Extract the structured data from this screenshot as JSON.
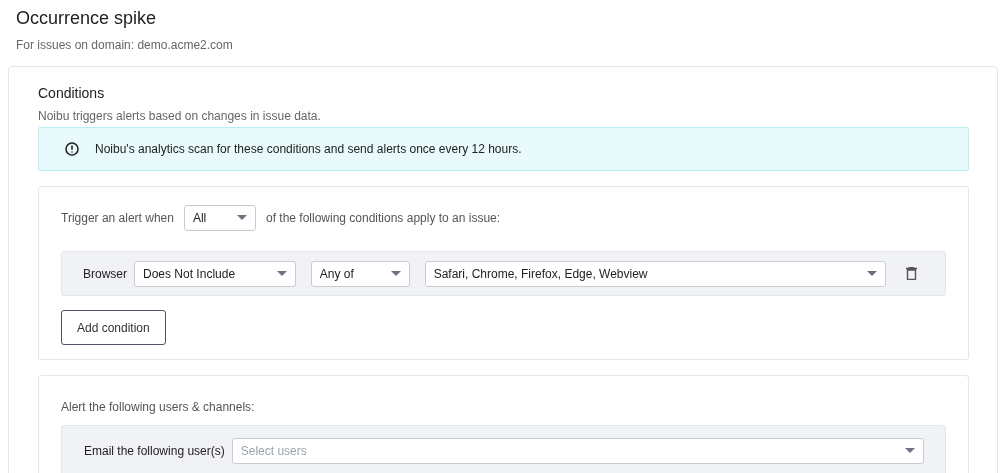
{
  "page": {
    "title": "Occurrence spike",
    "subtitle": "For issues on domain: demo.acme2.com"
  },
  "conditions": {
    "heading": "Conditions",
    "description": "Noibu triggers alerts based on changes in issue data.",
    "notice": "Noibu's analytics scan for these conditions and send alerts once every 12 hours.",
    "trigger": {
      "prefix": "Trigger an alert when",
      "match": "All",
      "suffix": "of the following conditions apply to an issue:"
    },
    "rows": [
      {
        "label": "Browser",
        "operator": "Does Not Include",
        "quantifier": "Any of",
        "values": "Safari, Chrome, Firefox, Edge, Webview"
      }
    ],
    "add_button": "Add condition"
  },
  "alerts": {
    "heading": "Alert the following users & channels:",
    "email_label": "Email the following user(s)",
    "email_placeholder": "Select users"
  }
}
